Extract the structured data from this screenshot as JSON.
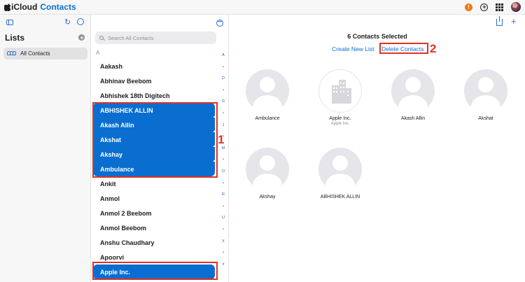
{
  "app": {
    "brand": "iCloud",
    "name": "Contacts",
    "alert": "!"
  },
  "icons": {
    "sidebar_toggle": "sidebar-icon",
    "refresh": "refresh-icon",
    "settings": "settings-icon",
    "more": "ellipsis-circle-icon",
    "search": "search-icon",
    "share": "share-icon",
    "add": "plus-icon"
  },
  "colors": {
    "accent": "#0a6ed1",
    "selection": "#0a6ed1",
    "annotation": "#e03323",
    "alert": "#f07b16"
  },
  "sidebar": {
    "title": "Lists",
    "items": [
      {
        "label": "All Contacts",
        "selected": true
      }
    ]
  },
  "search": {
    "placeholder": "Search All Contacts",
    "value": ""
  },
  "list": {
    "section": "A",
    "contacts": [
      {
        "name": "Aakash",
        "selected": false
      },
      {
        "name": "Abhinav Beebom",
        "selected": false
      },
      {
        "name": "Abhishek 18th Digitech",
        "selected": false
      },
      {
        "name": "ABHISHEK ALLIN",
        "selected": true
      },
      {
        "name": "Akash Allin",
        "selected": true
      },
      {
        "name": "Akshat",
        "selected": true
      },
      {
        "name": "Akshay",
        "selected": true
      },
      {
        "name": "Ambulance",
        "selected": true
      },
      {
        "name": "Ankit",
        "selected": false
      },
      {
        "name": "Anmol",
        "selected": false
      },
      {
        "name": "Anmol 2 Beebom",
        "selected": false
      },
      {
        "name": "Anmol Beebom",
        "selected": false
      },
      {
        "name": "Anshu Chaudhary",
        "selected": false
      },
      {
        "name": "Apoorvi",
        "selected": false
      },
      {
        "name": "Apple Inc.",
        "selected": true
      }
    ],
    "index": [
      "A",
      "•",
      "D",
      "•",
      "G",
      "•",
      "J",
      "•",
      "M",
      "•",
      "O",
      "•",
      "R",
      "•",
      "U",
      "•",
      "X",
      "•",
      "#"
    ]
  },
  "detail": {
    "title": "6 Contacts Selected",
    "create_list": "Create New List",
    "delete_contacts": "Delete Contacts",
    "cards": [
      {
        "name": "Ambulance",
        "sub": "",
        "type": "person"
      },
      {
        "name": "Apple Inc.",
        "sub": "Apple Inc.",
        "type": "company"
      },
      {
        "name": "Akash Allin",
        "sub": "",
        "type": "person"
      },
      {
        "name": "Akshat",
        "sub": "",
        "type": "person"
      },
      {
        "name": "Akshay",
        "sub": "",
        "type": "person"
      },
      {
        "name": "ABHISHEK ALLIN",
        "sub": "",
        "type": "person"
      }
    ]
  },
  "annotations": {
    "step1": "1",
    "step2": "2"
  }
}
